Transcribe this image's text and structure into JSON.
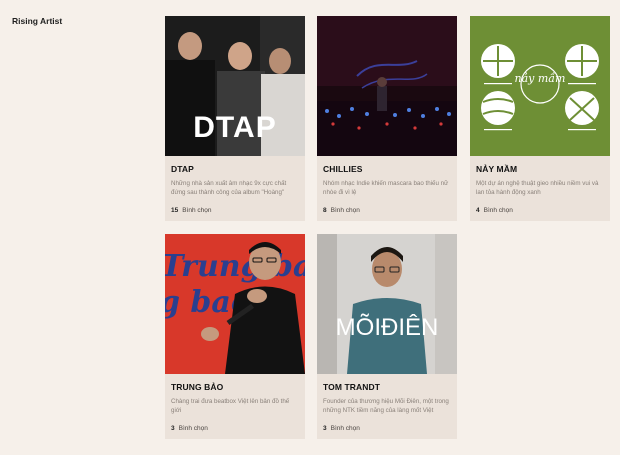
{
  "section": {
    "title": "Rising Artist"
  },
  "cards": [
    {
      "name": "DTAP",
      "description": "Những nhà sản xuất âm nhạc 9x cực chất đứng sau thành công của album \"Hoàng\"",
      "votes": "15",
      "vote_label": "Bình chọn",
      "overlay_text": "DTAP"
    },
    {
      "name": "CHILLIES",
      "description": "Nhóm nhạc Indie khiến mascara bao thiếu nữ nhòe đi vì lệ",
      "votes": "8",
      "vote_label": "Bình chọn"
    },
    {
      "name": "NẢY MẦM",
      "description": "Một dự án nghệ thuật gieo nhiều niềm vui và lan tỏa hành động xanh",
      "votes": "4",
      "vote_label": "Bình chọn",
      "overlay_text": "nảy mầm"
    },
    {
      "name": "TRUNG BẢO",
      "description": "Chàng trai đưa beatbox Việt lên bản đồ thế giới",
      "votes": "3",
      "vote_label": "Bình chọn",
      "overlay_text": "Trung bao"
    },
    {
      "name": "TOM TRANDT",
      "description": "Founder của thương hiệu Mõi Điên, một trong những NTK tiềm năng của làng mốt Việt",
      "votes": "3",
      "vote_label": "Bình chọn",
      "overlay_text": "MÕIĐIÊN"
    }
  ],
  "colors": {
    "page_bg": "#f6f0ea",
    "card_bg": "#ebe2da",
    "naymam_green": "#6e8f35",
    "trungbao_red": "#d8382a"
  }
}
